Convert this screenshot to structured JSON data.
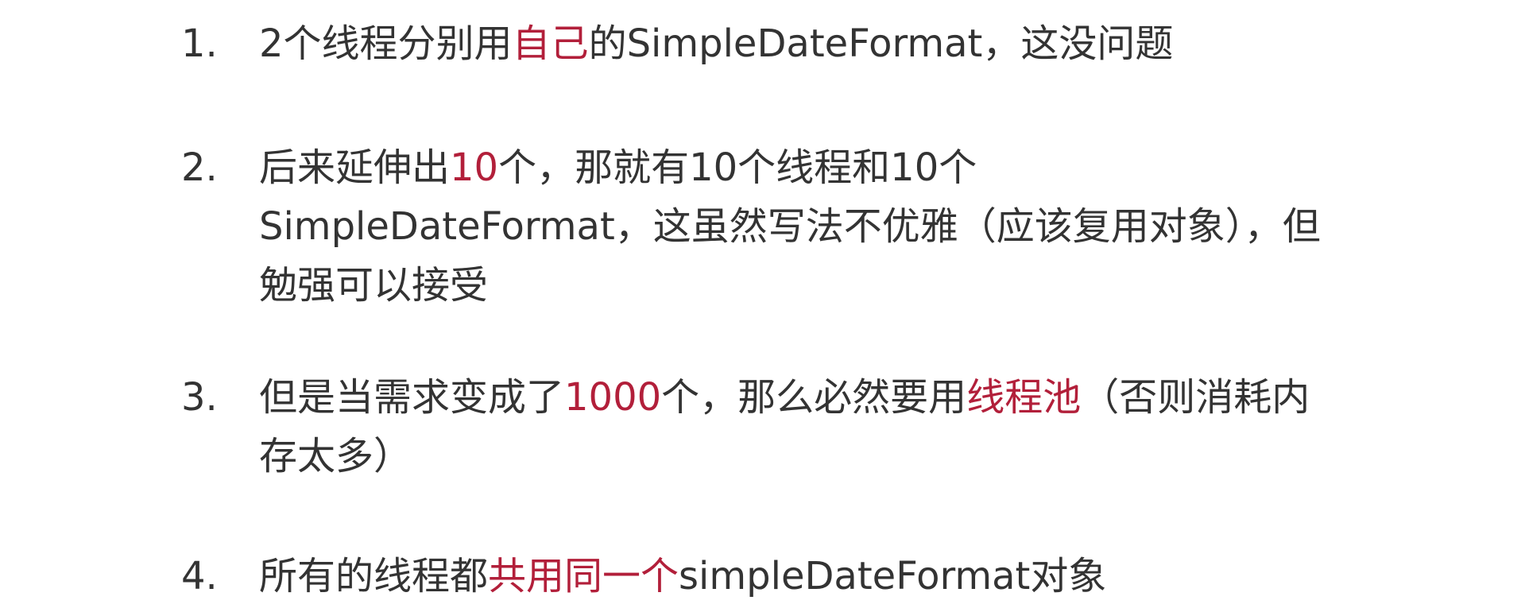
{
  "items": [
    {
      "number": "1.",
      "segments": [
        {
          "text": "2个线程分别用",
          "highlight": false
        },
        {
          "text": "自己",
          "highlight": true
        },
        {
          "text": "的SimpleDateFormat，这没问题",
          "highlight": false
        }
      ]
    },
    {
      "number": "2.",
      "segments": [
        {
          "text": "后来延伸出",
          "highlight": false
        },
        {
          "text": "10",
          "highlight": true
        },
        {
          "text": "个，那就有10个线程和10个SimpleDateFormat，这虽然写法不优雅（应该复用对象），但勉强可以接受",
          "highlight": false
        }
      ]
    },
    {
      "number": "3.",
      "segments": [
        {
          "text": "但是当需求变成了",
          "highlight": false
        },
        {
          "text": "1000",
          "highlight": true
        },
        {
          "text": "个，那么必然要用",
          "highlight": false
        },
        {
          "text": "线程池",
          "highlight": true
        },
        {
          "text": "（否则消耗内存太多）",
          "highlight": false
        }
      ]
    },
    {
      "number": "4.",
      "segments": [
        {
          "text": "所有的线程都",
          "highlight": false
        },
        {
          "text": "共用同一个",
          "highlight": true
        },
        {
          "text": "simpleDateFormat对象",
          "highlight": false
        }
      ]
    }
  ],
  "colors": {
    "text": "#333333",
    "highlight": "#b21f3a",
    "background": "#ffffff"
  }
}
